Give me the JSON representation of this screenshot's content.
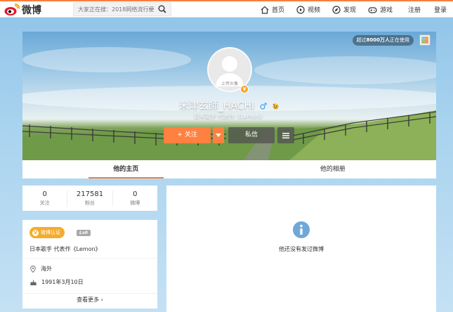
{
  "header": {
    "logo_text": "微博",
    "search_placeholder": "大家正在搜：2018网络流行梗",
    "nav": [
      {
        "label": "首页",
        "icon": "home-icon"
      },
      {
        "label": "视频",
        "icon": "video-icon"
      },
      {
        "label": "发现",
        "icon": "discover-icon"
      },
      {
        "label": "游戏",
        "icon": "game-icon"
      },
      {
        "label": "注册"
      },
      {
        "label": "登录"
      }
    ]
  },
  "banner": {
    "online_prefix": "超过",
    "online_count": "8000万人",
    "online_suffix": "正在使用",
    "avatar_label": "上传头像",
    "username": "米津玄師_HACHI",
    "bio": "日本歌手 代表作《Lemon》",
    "follow_label": "+ 关注",
    "message_label": "私信"
  },
  "tabs": [
    {
      "label": "他的主页",
      "active": true
    },
    {
      "label": "他的相册",
      "active": false
    }
  ],
  "stats": [
    {
      "value": "0",
      "label": "关注"
    },
    {
      "value": "217581",
      "label": "粉丝"
    },
    {
      "value": "0",
      "label": "微博"
    }
  ],
  "profile": {
    "cert_label": "微博认证",
    "level": "Lv0",
    "description": "日本歌手 代表作《Lemon》",
    "location": "海外",
    "birthday": "1991年3月10日",
    "more_label": "查看更多 ›"
  },
  "feed": {
    "empty_text": "他还没有发过微博"
  },
  "colors": {
    "accent": "#fa7d3c",
    "follow_button": "#ff8140",
    "cert_badge": "#f6ab2c",
    "info_icon": "#6fa8d8"
  }
}
